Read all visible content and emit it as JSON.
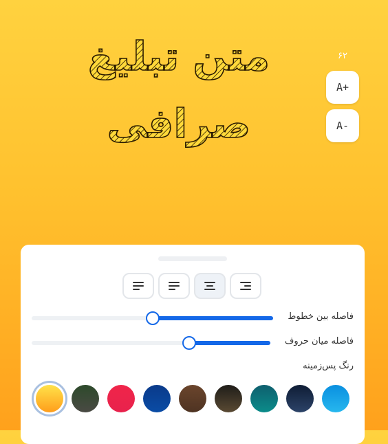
{
  "preview": {
    "line1": "متن تبلیغ",
    "line2": "صرافی"
  },
  "font_size": {
    "value": "۶۲",
    "increase_label": "A+",
    "decrease_label": "A-"
  },
  "panel": {
    "alignment": {
      "options": [
        "left",
        "right",
        "center",
        "justify"
      ],
      "selected": "center"
    },
    "line_spacing": {
      "label": "فاصله بین خطوط",
      "value_fraction": 0.5
    },
    "letter_spacing": {
      "label": "فاصله میان حروف",
      "value_fraction": 0.66
    },
    "background_label": "رنگ پس‌زمینه",
    "colors": [
      {
        "name": "yellow",
        "from": "#FFE24A",
        "to": "#FF9E1B",
        "selected": true
      },
      {
        "name": "forest",
        "from": "#2D4A2B",
        "to": "#4A4A44",
        "selected": false
      },
      {
        "name": "red",
        "from": "#F0254A",
        "to": "#E8224C",
        "selected": false
      },
      {
        "name": "navy",
        "from": "#0A3A8A",
        "to": "#0A4CA5",
        "selected": false
      },
      {
        "name": "brown",
        "from": "#6B452C",
        "to": "#4E3322",
        "selected": false
      },
      {
        "name": "dark-brown",
        "from": "#1F1D19",
        "to": "#5A4A33",
        "selected": false
      },
      {
        "name": "teal",
        "from": "#0E5F6E",
        "to": "#0B8C8A",
        "selected": false
      },
      {
        "name": "midnight",
        "from": "#0F1D35",
        "to": "#2C4368",
        "selected": false
      },
      {
        "name": "sky",
        "from": "#0A8FE0",
        "to": "#27B7EE",
        "selected": false
      }
    ]
  }
}
